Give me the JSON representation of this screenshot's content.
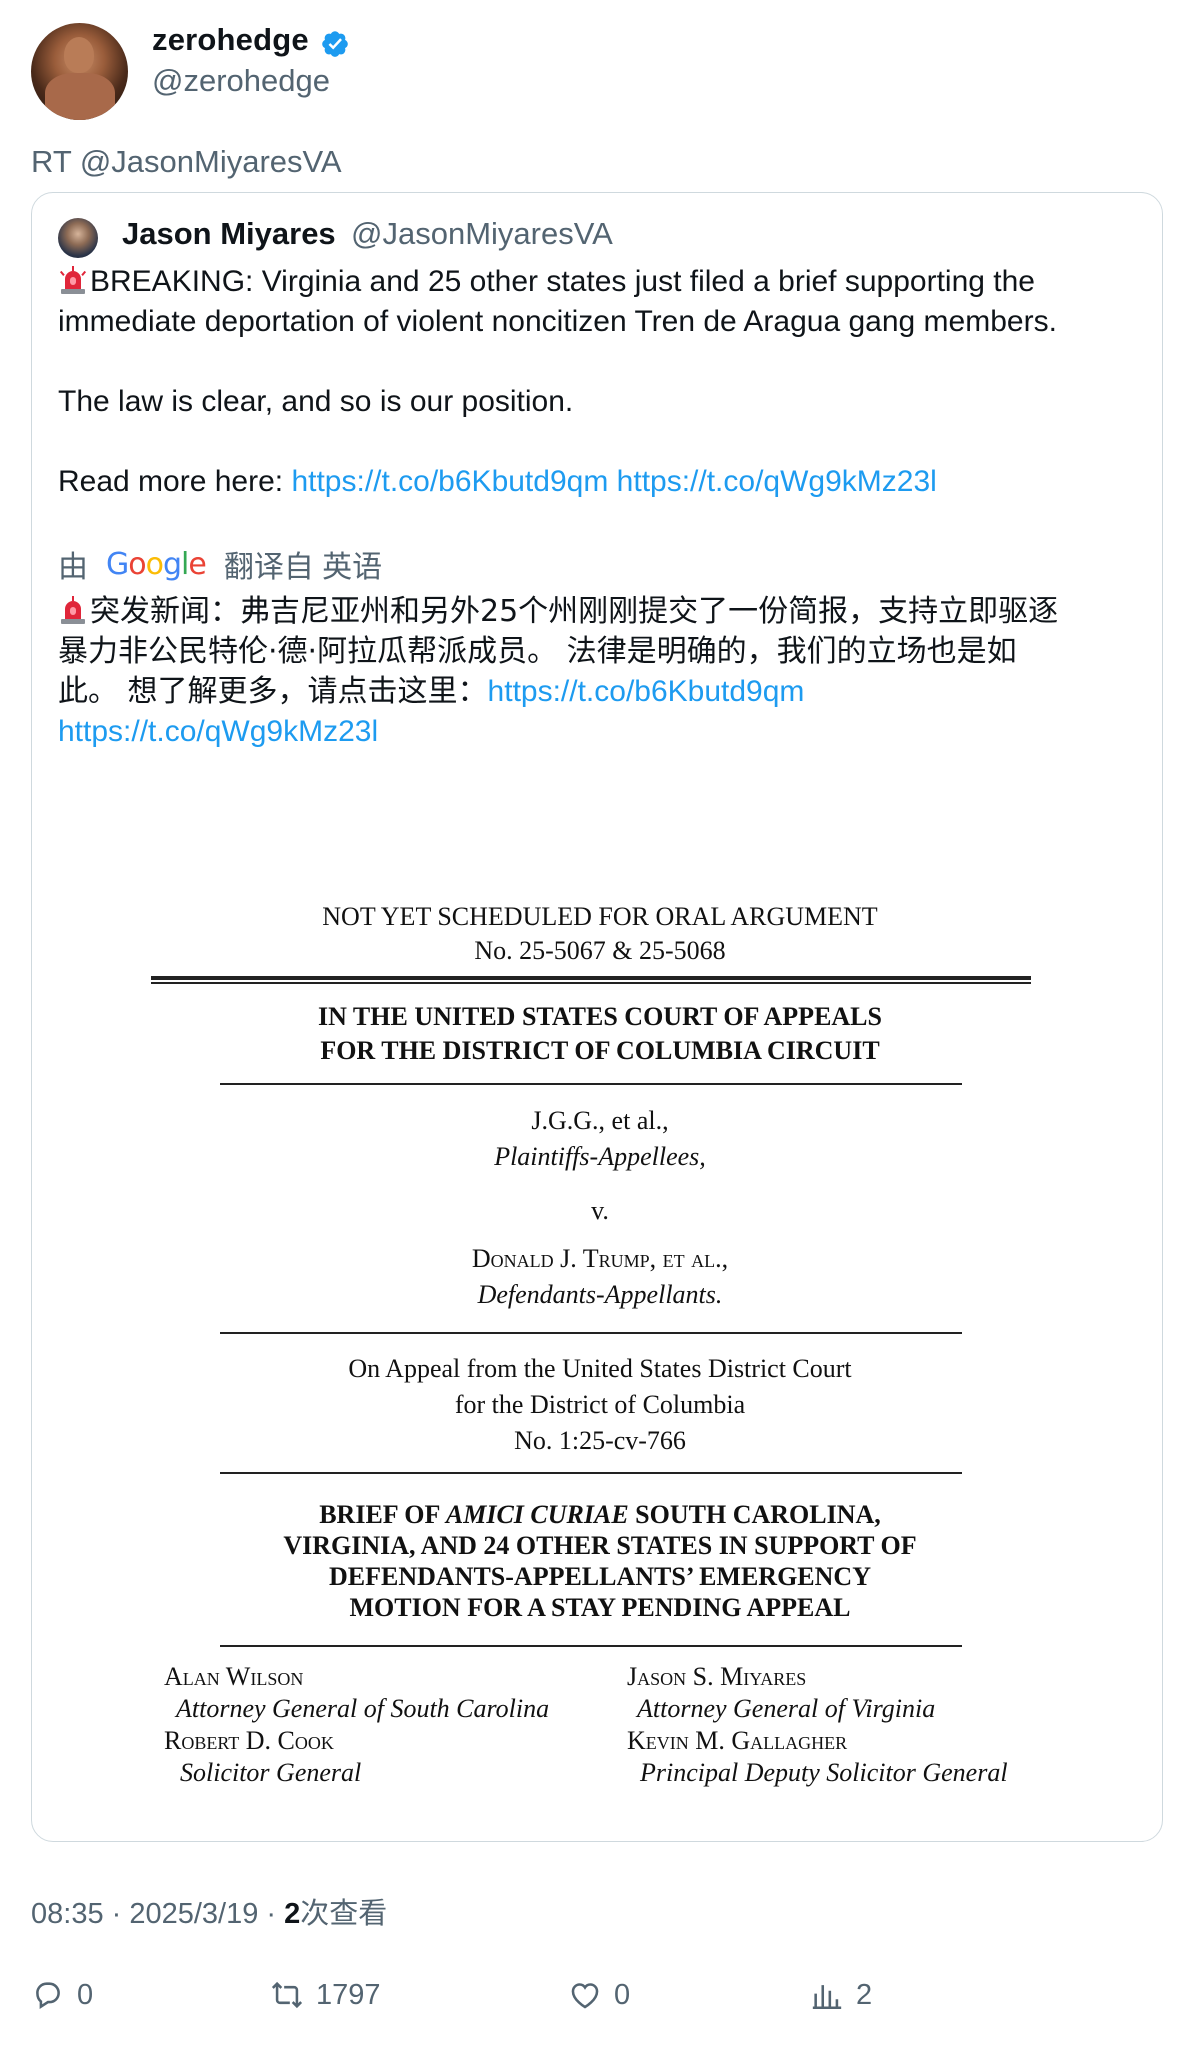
{
  "retweeter": {
    "name": "zerohedge",
    "handle": "@zerohedge",
    "rt_label": "RT @JasonMiyaresVA"
  },
  "quoted": {
    "name": "Jason Miyares",
    "handle": "@JasonMiyaresVA",
    "text_line1": "BREAKING: Virginia and 25 other states just filed a brief supporting the",
    "text_line2": "immediate deportation of violent noncitizen Tren de Aragua gang members.",
    "text_line3": "The law is clear, and so is our position.",
    "read_more": "Read more here: ",
    "link1": "https://t.co/b6Kbutd9qm",
    "link2": "https://t.co/qWg9kMz23l",
    "translate_by": "由",
    "translate_brand": "Google",
    "translate_from": "翻译自 英语",
    "zh_line1": "突发新闻：弗吉尼亚州和另外25个州刚刚提交了一份简报，支持立即驱逐",
    "zh_line2": "暴力非公民特伦·德·阿拉瓜帮派成员。 法律是明确的，我们的立场也是如",
    "zh_line3": "此。 想了解更多，请点击这里：",
    "zh_link1": "https://t.co/b6Kbutd9qm",
    "zh_link2": "https://t.co/qWg9kMz23l"
  },
  "document": {
    "line1": "NOT YET SCHEDULED FOR ORAL ARGUMENT",
    "line2": "No. 25-5067 & 25-5068",
    "court1": "IN THE UNITED STATES COURT OF APPEALS",
    "court2": "FOR THE DISTRICT OF COLUMBIA CIRCUIT",
    "party1": "J.G.G., et al.,",
    "party1_role": "Plaintiffs-Appellees,",
    "versus": "v.",
    "party2": "Donald J. Trump, et al.,",
    "party2_role": "Defendants-Appellants.",
    "appeal1": "On Appeal from the United States District Court",
    "appeal2": "for the District of Columbia",
    "appeal3": "No. 1:25-cv-766",
    "brief1_pre": "BRIEF OF ",
    "brief1_it": "AMICI CURIAE",
    "brief1_post": " SOUTH CAROLINA,",
    "brief2": "VIRGINIA, AND 24 OTHER STATES IN SUPPORT OF",
    "brief3": "DEFENDANTS-APPELLANTS’ EMERGENCY",
    "brief4": "MOTION FOR A STAY PENDING APPEAL",
    "sig_left_name1": "Alan Wilson",
    "sig_left_title1": "Attorney General of South Carolina",
    "sig_left_name2": "Robert D. Cook",
    "sig_left_title2": "Solicitor General",
    "sig_right_name1": "Jason S. Miyares",
    "sig_right_title1": "Attorney General of Virginia",
    "sig_right_name2": "Kevin M. Gallagher",
    "sig_right_title2": "Principal Deputy Solicitor General"
  },
  "footer": {
    "time": "08:35 · 2025/3/19 · ",
    "views_count": "2",
    "views_label": "次查看"
  },
  "actions": {
    "replies": "0",
    "retweets": "1797",
    "likes": "0",
    "views": "2"
  },
  "colors": {
    "link": "#1d9bf0",
    "muted": "#536471",
    "verified": "#1d9bf0",
    "border": "#cfd9de"
  },
  "icons": [
    "verified-badge-icon",
    "siren-emoji-icon",
    "reply-icon",
    "retweet-icon",
    "like-icon",
    "views-icon"
  ]
}
